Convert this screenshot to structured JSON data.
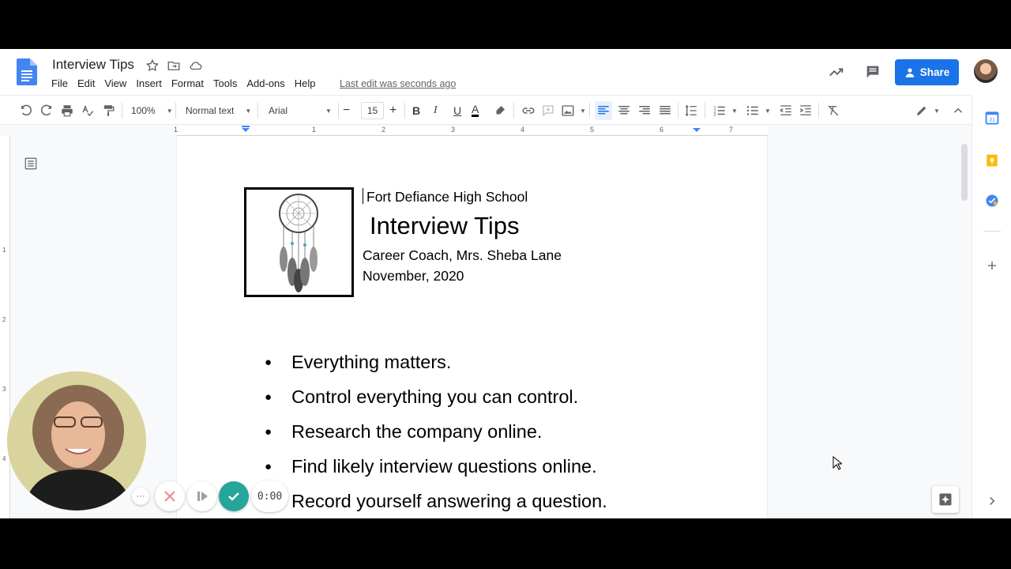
{
  "doc": {
    "title": "Interview Tips",
    "last_edit": "Last edit was seconds ago"
  },
  "menu": [
    "File",
    "Edit",
    "View",
    "Insert",
    "Format",
    "Tools",
    "Add-ons",
    "Help"
  ],
  "header": {
    "share_label": "Share"
  },
  "toolbar": {
    "zoom": "100%",
    "style": "Normal text",
    "font": "Arial",
    "font_size": "15"
  },
  "ruler": {
    "labels": [
      "1",
      "1",
      "2",
      "3",
      "4",
      "5",
      "6",
      "7"
    ]
  },
  "vruler": {
    "labels": [
      "1",
      "2",
      "3",
      "4"
    ]
  },
  "content": {
    "school": "Fort Defiance High School",
    "heading": "Interview Tips",
    "coach": "Career Coach, Mrs. Sheba Lane",
    "date": "November, 2020",
    "bullets": [
      "Everything matters.",
      "Control everything you can control.",
      "Research the company online.",
      "Find likely interview questions online.",
      "Record yourself answering a question."
    ],
    "bullet_char": "●"
  },
  "recorder": {
    "time": "0:00"
  },
  "colors": {
    "accent": "#1a73e8",
    "docs_blue": "#4285f4",
    "keep_yellow": "#fbbc04",
    "tasks_blue": "#4285f4",
    "cancel_red": "#ea4335",
    "done_teal": "#26a69a"
  }
}
